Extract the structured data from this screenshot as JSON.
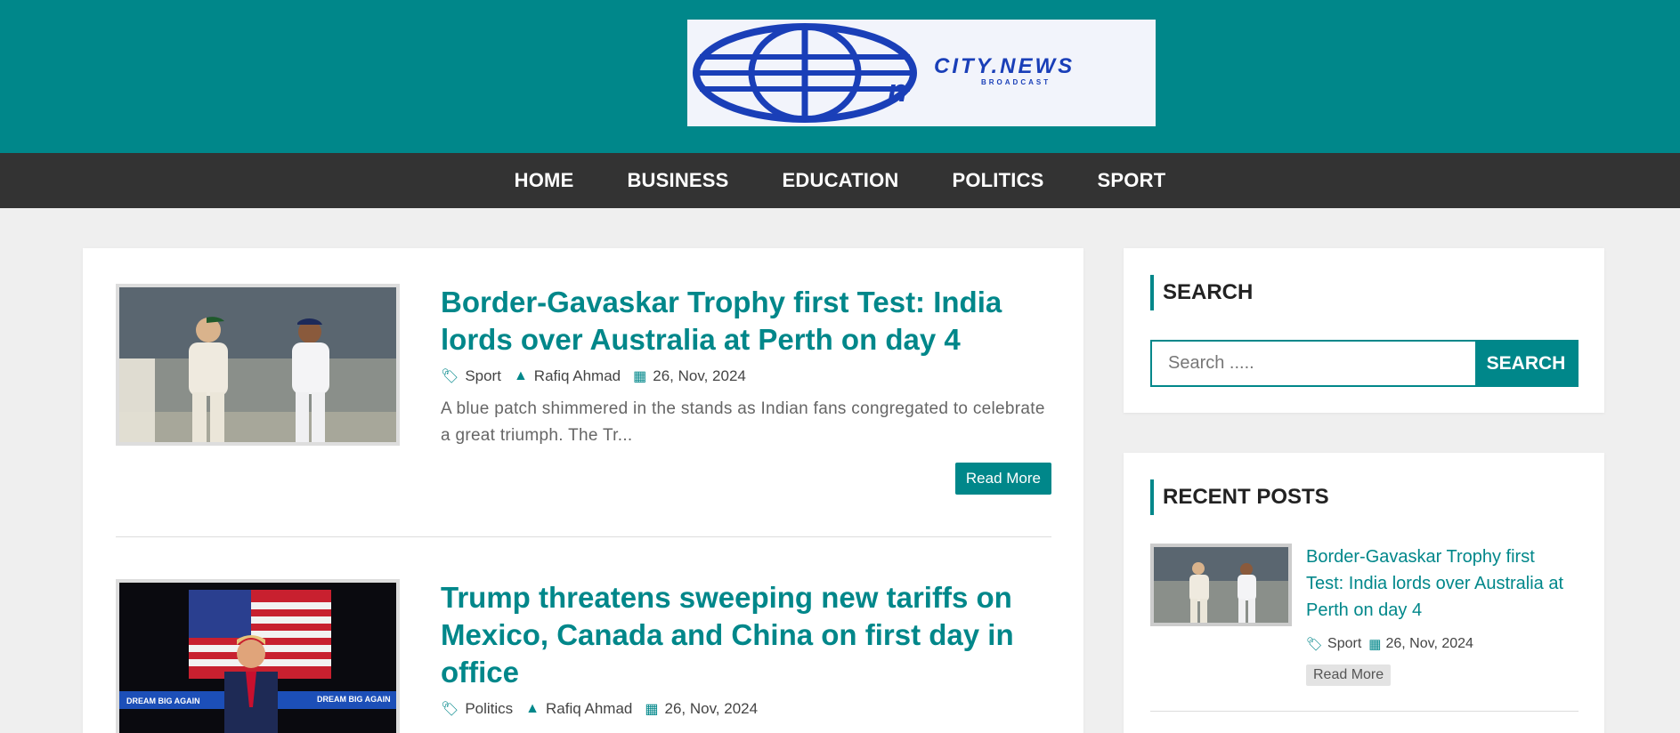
{
  "logo": {
    "text": "CITY.NEWS",
    "subtext": "BROADCAST"
  },
  "nav": [
    "HOME",
    "BUSINESS",
    "EDUCATION",
    "POLITICS",
    "SPORT"
  ],
  "posts": [
    {
      "title": "Border-Gavaskar Trophy first Test: India lords over Australia at Perth on day 4",
      "category": "Sport",
      "author": "Rafiq Ahmad",
      "date": "26, Nov, 2024",
      "excerpt": "A blue patch shimmered in the stands as Indian fans congregated to celebrate a great triumph. The Tr...",
      "read_more": "Read More"
    },
    {
      "title": "Trump threatens sweeping new tariffs on Mexico, Canada and China on first day in office",
      "category": "Politics",
      "author": "Rafiq Ahmad",
      "date": "26, Nov, 2024",
      "thumb_banner": "DREAM BIG AGAIN"
    }
  ],
  "sidebar": {
    "search": {
      "title": "SEARCH",
      "placeholder": "Search .....",
      "button": "SEARCH"
    },
    "recent": {
      "title": "RECENT POSTS",
      "items": [
        {
          "title": "Border-Gavaskar Trophy first Test: India lords over Australia at Perth on day 4",
          "category": "Sport",
          "date": "26, Nov, 2024",
          "read_more": "Read More"
        }
      ]
    }
  },
  "colors": {
    "accent": "#00878a",
    "nav_bg": "#333333",
    "page_bg": "#efefef"
  }
}
